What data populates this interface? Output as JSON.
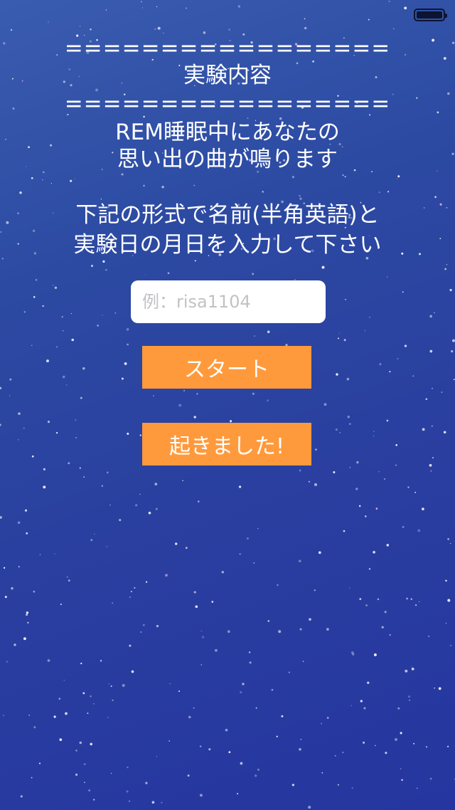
{
  "status_bar": {
    "battery_icon": "battery-full-icon"
  },
  "header": {
    "divider_top": "=================",
    "title": "実験内容",
    "divider_bottom": "================="
  },
  "description": {
    "line1": "REM睡眠中にあなたの",
    "line2": "思い出の曲が鳴ります"
  },
  "instruction": {
    "line1": "下記の形式で名前(半角英語)と",
    "line2": "実験日の月日を入力して下さい"
  },
  "name_input": {
    "placeholder": "例：risa1104",
    "value": ""
  },
  "buttons": {
    "start_label": "スタート",
    "wake_label": "起きました!"
  },
  "colors": {
    "button": "#ff9a3c",
    "background": "#2c4aa2",
    "text": "#ffffff"
  }
}
